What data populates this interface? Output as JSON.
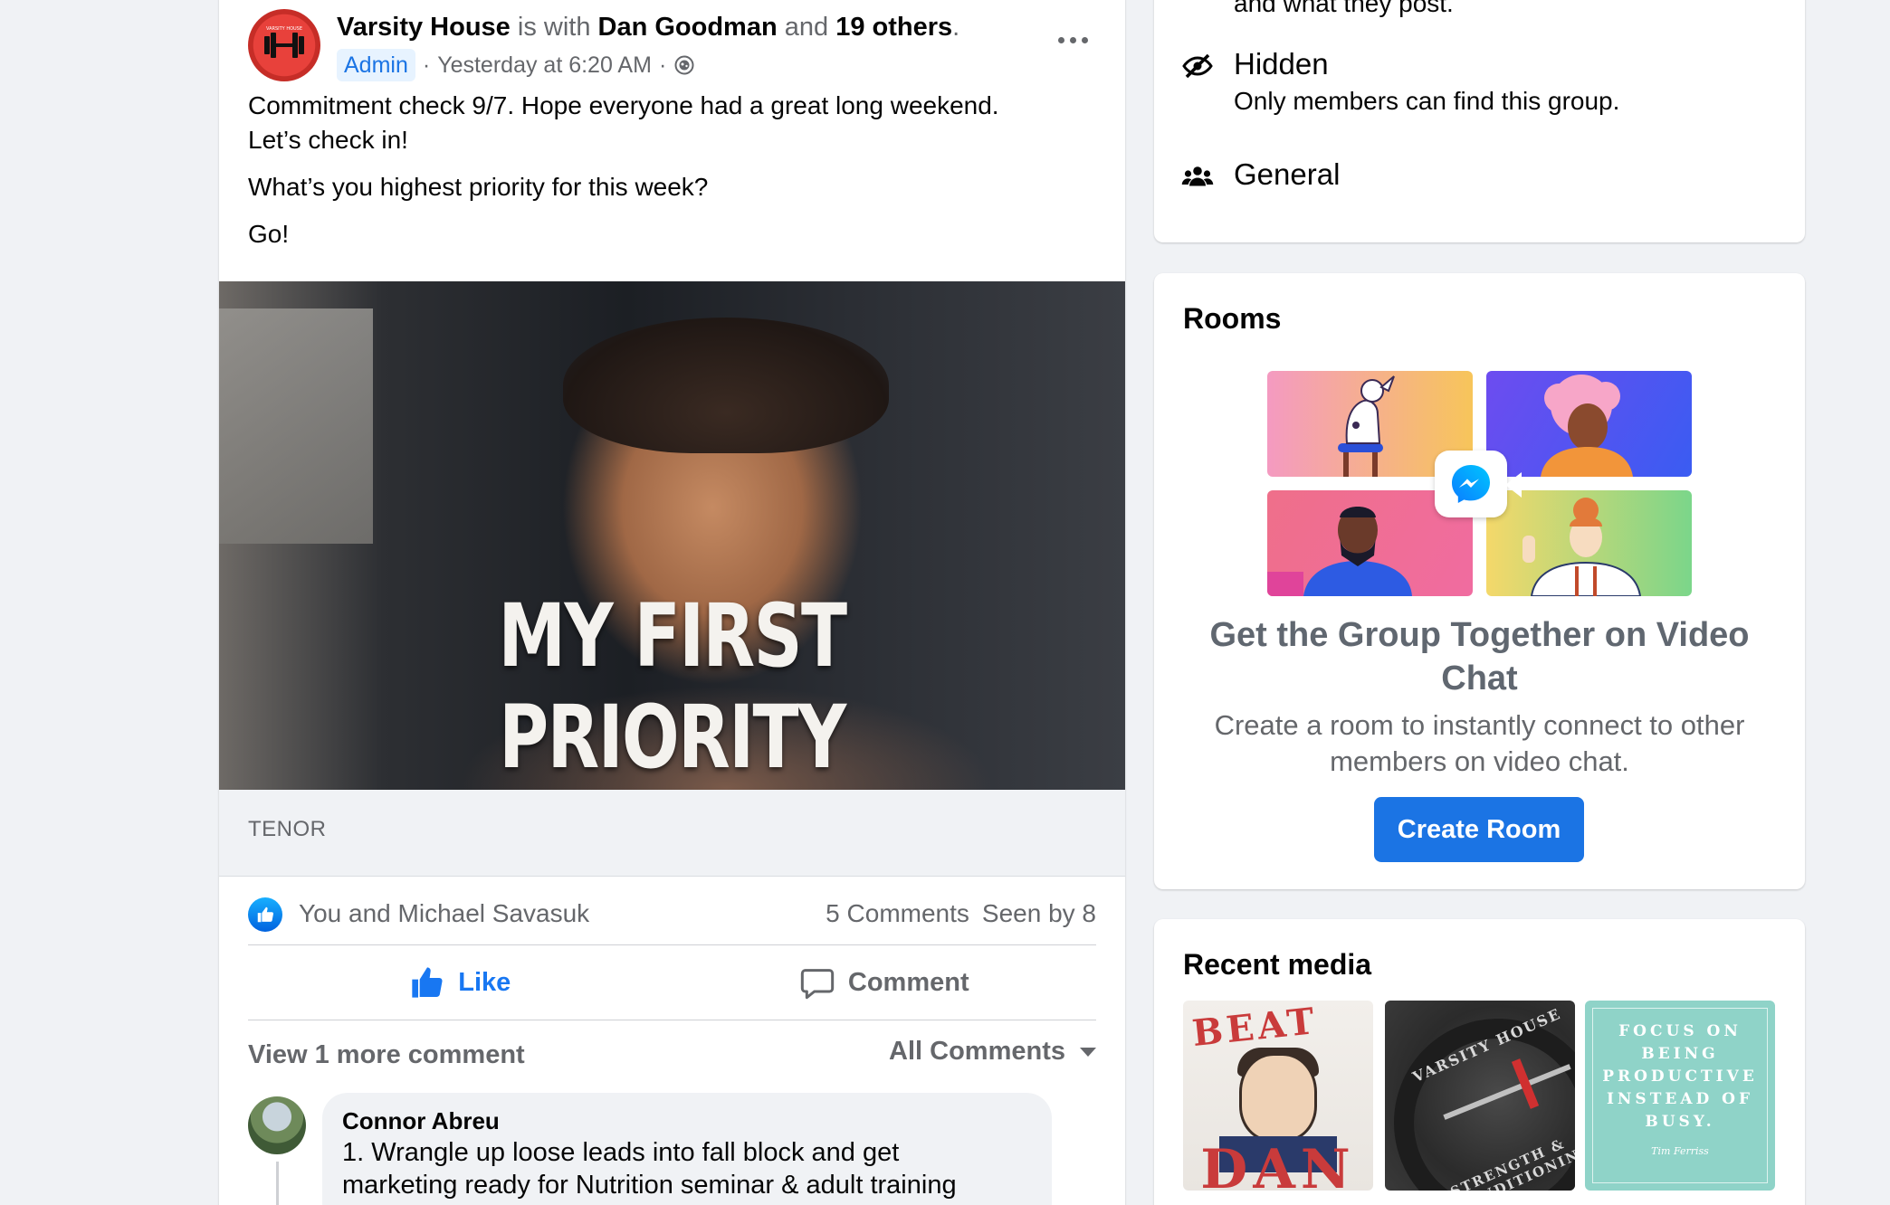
{
  "post": {
    "group_name": "Varsity House",
    "with_text": " is with ",
    "tagged_person": "Dan Goodman",
    "and_text": " and ",
    "others": "19 others",
    "period": ".",
    "admin_badge": "Admin",
    "sep1": "·",
    "timestamp": "Yesterday at 6:20 AM",
    "sep2": "·",
    "audience_icon": "globe-icon",
    "body_line1": "Commitment check 9/7. Hope everyone had a great long weekend.",
    "body_line2": "Let’s check in!",
    "body_line3": "What’s you highest priority for this week?",
    "body_line4": "Go!",
    "gif_caption": "MY FIRST PRIORITY",
    "gif_source": "TENOR",
    "reactors": "You and Michael Savasuk",
    "comments_count": "5 Comments",
    "seen_by": "Seen by 8",
    "like_label": "Like",
    "comment_label": "Comment",
    "view_more": "View 1 more comment",
    "all_comments": "All Comments",
    "comment": {
      "author": "Connor Abreu",
      "line1": "1. Wrangle up loose leads into fall block and get",
      "line2": "marketing ready for Nutrition seminar & adult training"
    }
  },
  "about": {
    "cut_text": "and what they post.",
    "hidden_title": "Hidden",
    "hidden_desc": "Only members can find this group.",
    "general_title": "General"
  },
  "rooms": {
    "title": "Rooms",
    "heading": "Get the Group Together on Video Chat",
    "description": "Create a room to instantly connect to other members on video chat.",
    "button": "Create Room"
  },
  "media": {
    "title": "Recent media",
    "thumb1_top": "BEAT",
    "thumb1_bottom": "DAN",
    "thumb2_top": "VARSITY HOUSE",
    "thumb2_bottom": "STRENGTH & CONDITIONING",
    "thumb3_quote": "FOCUS ON BEING PRODUCTIVE INSTEAD OF BUSY.",
    "thumb3_sig": "Tim Ferriss"
  },
  "colors": {
    "accent": "#1877f2",
    "button": "#1b74e4",
    "background": "#f0f2f5",
    "muted_text": "#65676b"
  }
}
